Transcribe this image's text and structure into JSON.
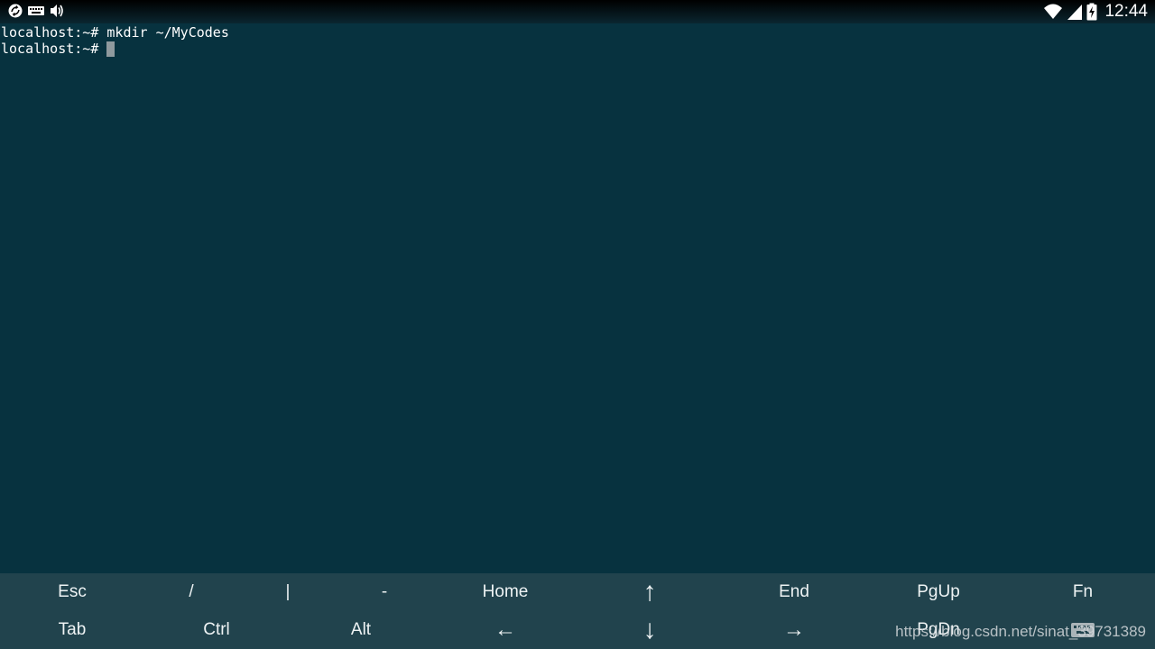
{
  "status_bar": {
    "left_icons": [
      "sync-icon",
      "keyboard-icon",
      "volume-icon"
    ],
    "right_icons": [
      "wifi-icon",
      "signal-icon",
      "battery-charging-icon"
    ],
    "clock": "12:44"
  },
  "terminal": {
    "lines": [
      {
        "prompt": "localhost:~#",
        "command": " mkdir ~/MyCodes"
      },
      {
        "prompt": "localhost:~#",
        "command": ""
      }
    ]
  },
  "extra_keys": {
    "row1": [
      "Esc",
      "/",
      "|",
      "-",
      "Home",
      "↑",
      "End",
      "PgUp",
      "Fn"
    ],
    "row2": [
      "Tab",
      "Ctrl",
      "Alt",
      "←",
      "↓",
      "→",
      "PgDn",
      "⌨",
      ""
    ]
  },
  "watermark": "https://blog.csdn.net/sinat_39731389",
  "colors": {
    "terminal_bg": "#07323f",
    "extra_keys_bg": "#21434d",
    "cursor": "#8f9a9e"
  }
}
